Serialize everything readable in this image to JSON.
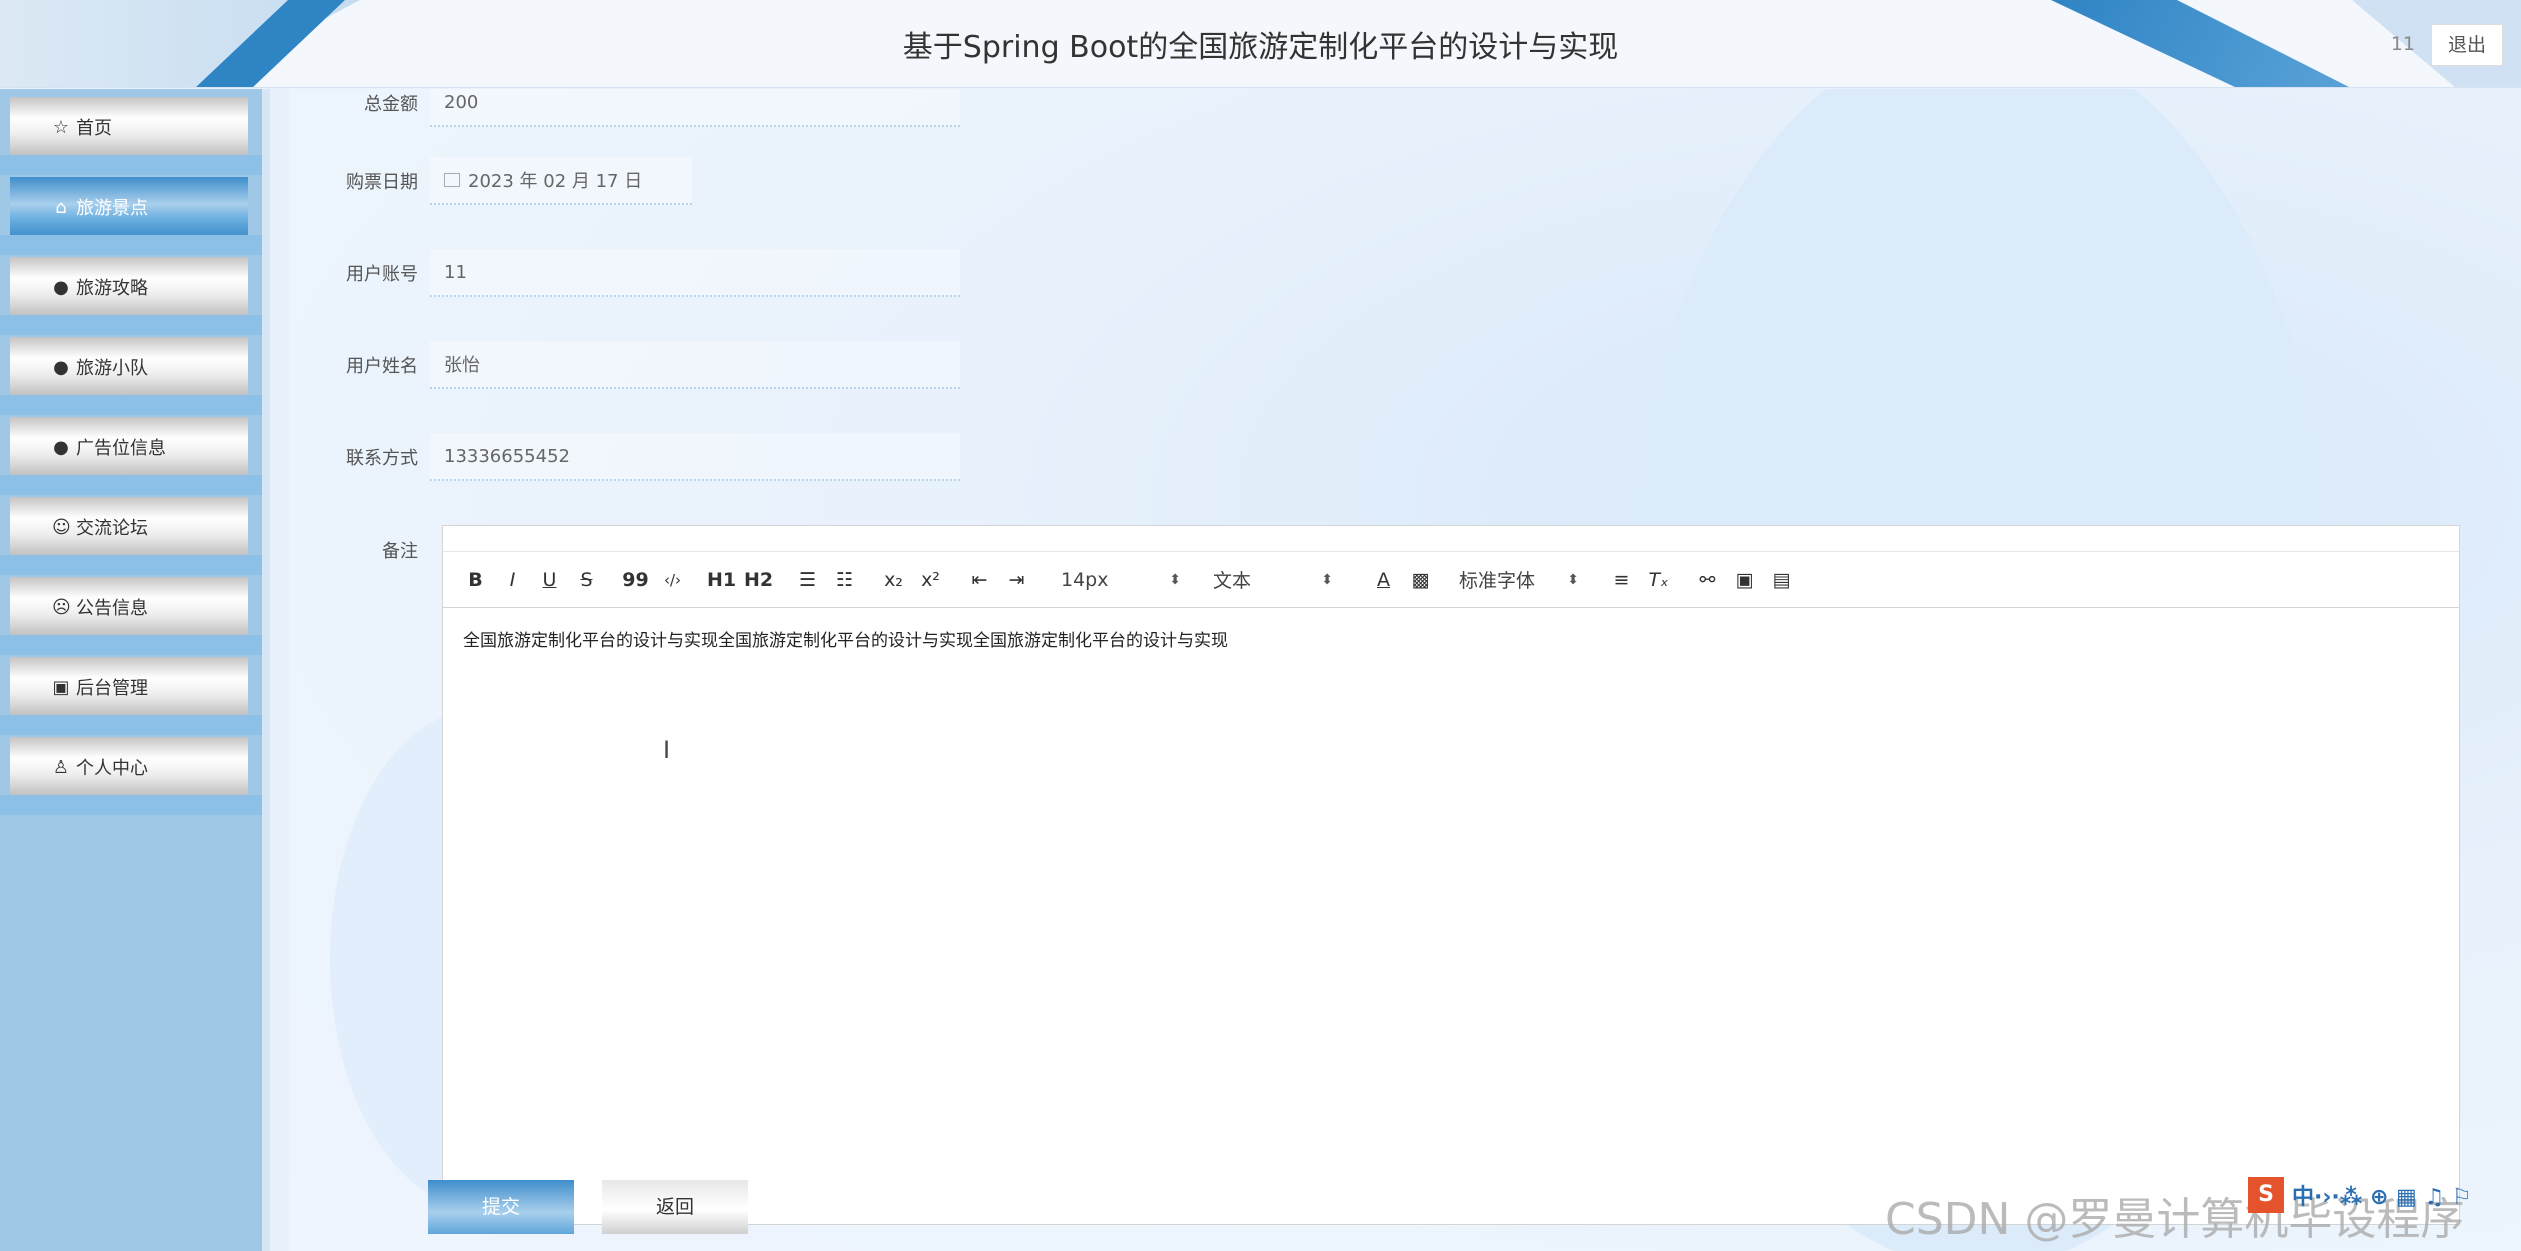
{
  "header": {
    "title": "基于Spring Boot的全国旅游定制化平台的设计与实现",
    "user": "11",
    "logout_label": "退出"
  },
  "sidebar": {
    "items": [
      {
        "label": "首页",
        "icon": "star-icon",
        "active": false
      },
      {
        "label": "旅游景点",
        "icon": "bag-icon",
        "active": true
      },
      {
        "label": "旅游攻略",
        "icon": "alert-icon",
        "active": false
      },
      {
        "label": "旅游小队",
        "icon": "help-icon",
        "active": false
      },
      {
        "label": "广告位信息",
        "icon": "info-icon",
        "active": false
      },
      {
        "label": "交流论坛",
        "icon": "smile-icon",
        "active": false
      },
      {
        "label": "公告信息",
        "icon": "face-icon",
        "active": false
      },
      {
        "label": "后台管理",
        "icon": "briefcase-icon",
        "active": false
      },
      {
        "label": "个人中心",
        "icon": "user-icon",
        "active": false
      }
    ]
  },
  "form": {
    "total_label": "总金额",
    "total_value": "200",
    "date_label": "购票日期",
    "date_value": "2023 年 02 月 17 日",
    "account_label": "用户账号",
    "account_value": "11",
    "name_label": "用户姓名",
    "name_value": "张怡",
    "phone_label": "联系方式",
    "phone_value": "13336655452",
    "note_label": "备注"
  },
  "editor": {
    "toolbar": {
      "bold": "B",
      "italic": "I",
      "underline": "U",
      "strike": "S",
      "quote": "99",
      "code": "‹/›",
      "h1": "H1",
      "h2": "H2",
      "sub": "x₂",
      "sup": "x²",
      "size_value": "14px",
      "format_value": "文本",
      "font_value": "标准字体"
    },
    "content": "全国旅游定制化平台的设计与实现全国旅游定制化平台的设计与实现全国旅游定制化平台的设计与实现"
  },
  "actions": {
    "submit_label": "提交",
    "back_label": "返回"
  },
  "watermark": "CSDN @罗曼计算机毕设程序",
  "ime": {
    "logo": "S",
    "text": "中·›·⁂ ⊕ ▦ ♫ ⚐"
  }
}
